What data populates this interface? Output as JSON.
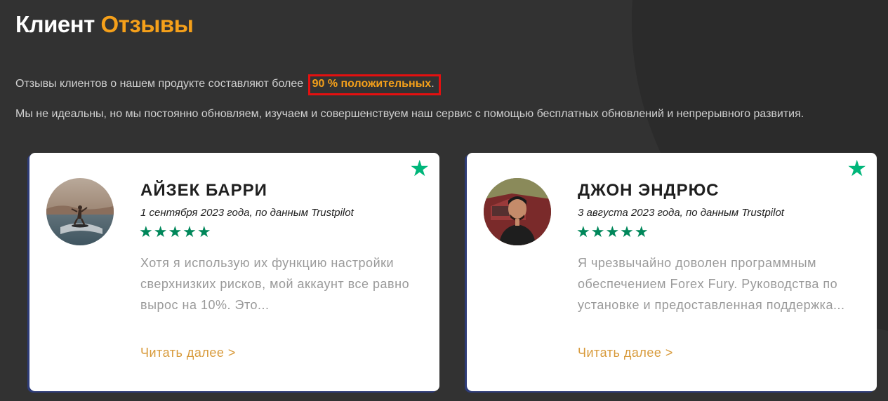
{
  "section": {
    "title_main": "Клиент",
    "title_accent": "Отзывы",
    "intro_prefix": "Отзывы клиентов о нашем продукте составляют более ",
    "intro_highlight": "90 % положительных",
    "intro_suffix": ".",
    "description": "Мы не идеальны, но мы постоянно обновляем, изучаем и совершенствуем наш сервис с помощью бесплатных обновлений и непрерывного развития."
  },
  "reviews": [
    {
      "name": "АЙЗЕК БАРРИ",
      "date": "1 сентября 2023 года, по данным Trustpilot",
      "rating_stars": 5,
      "stars_text": "★★★★★",
      "badge_star": "★",
      "quote": "Хотя я использую их функцию настройки сверхнизких рисков, мой аккаунт все равно вырос на 10%. Это...",
      "read_more": "Читать далее >"
    },
    {
      "name": "ДЖОН ЭНДРЮС",
      "date": "3 августа 2023 года, по данным Trustpilot",
      "rating_stars": 5,
      "stars_text": "★★★★★",
      "badge_star": "★",
      "quote": "Я чрезвычайно доволен программным обеспечением Forex Fury. Руководства по установке и предоставленная поддержка...",
      "read_more": "Читать далее >"
    }
  ],
  "colors": {
    "accent": "#f5a01a",
    "trustpilot_green": "#00b67a",
    "highlight_border": "#e41010",
    "background": "#323232"
  }
}
